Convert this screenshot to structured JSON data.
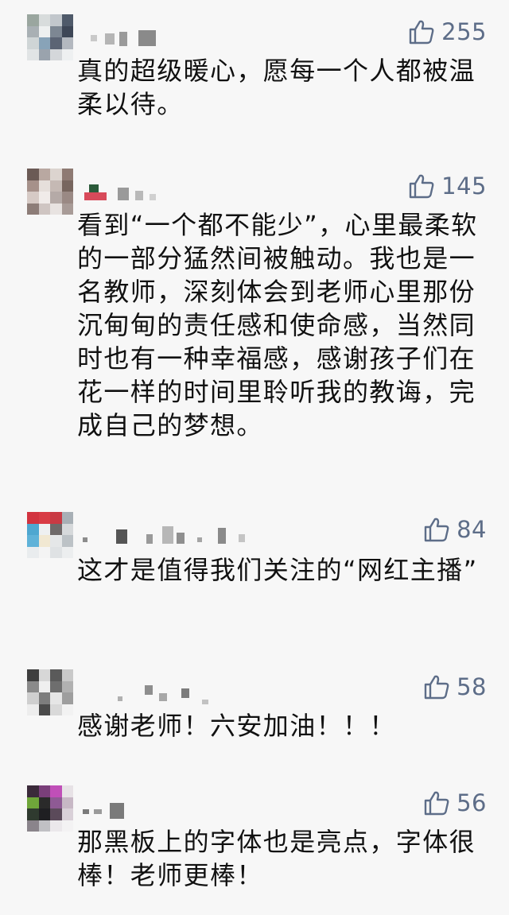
{
  "comments": [
    {
      "likes": "255",
      "text": "真的超级暖心，愿每一个人都被温柔以待。"
    },
    {
      "likes": "145",
      "text": "看到“一个都不能少”，心里最柔软的一部分猛然间被触动。我也是一名教师，深刻体会到老师心里那份沉甸甸的责任感和使命感，当然同时也有一种幸福感，感谢孩子们在花一样的时间里聆听我的教诲，完成自己的梦想。"
    },
    {
      "likes": "84",
      "text": "这才是值得我们关注的“网红主播”"
    },
    {
      "likes": "58",
      "text": "感谢老师！六安加油！！！"
    },
    {
      "likes": "56",
      "text": "那黑板上的字体也是亮点，字体很棒！老师更棒！"
    }
  ],
  "icons": {
    "like": "thumbs-up-icon"
  },
  "colors": {
    "like_accent": "#5d6d88",
    "background": "#f7f7f7",
    "text": "#111111"
  }
}
